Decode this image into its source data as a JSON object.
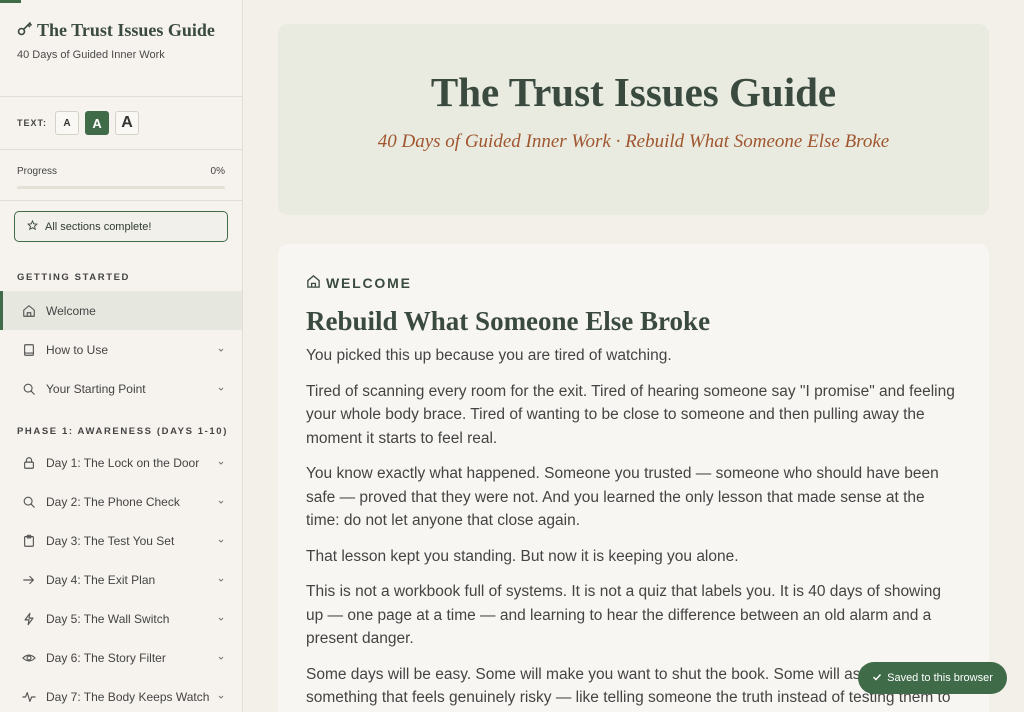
{
  "sidebar": {
    "brand_title": "The Trust Issues Guide",
    "brand_subtitle": "40 Days of Guided Inner Work",
    "text_size_label": "TEXT:",
    "text_size_options": [
      "A",
      "A",
      "A"
    ],
    "text_size_active": 1,
    "progress_label": "Progress",
    "progress_value": "0%",
    "progress_fraction": 0,
    "complete_button": "All sections complete!",
    "sections": [
      {
        "label": "GETTING STARTED",
        "items": [
          {
            "label": "Welcome",
            "icon": "home-icon",
            "active": true
          },
          {
            "label": "How to Use",
            "icon": "book-icon"
          },
          {
            "label": "Your Starting Point",
            "icon": "search-icon"
          }
        ]
      },
      {
        "label": "PHASE 1: AWARENESS (DAYS 1-10)",
        "items": [
          {
            "label": "Day 1: The Lock on the Door",
            "icon": "lock-icon"
          },
          {
            "label": "Day 2: The Phone Check",
            "icon": "search-icon"
          },
          {
            "label": "Day 3: The Test You Set",
            "icon": "clipboard-icon"
          },
          {
            "label": "Day 4: The Exit Plan",
            "icon": "arrow-right-icon"
          },
          {
            "label": "Day 5: The Wall Switch",
            "icon": "lightning-icon"
          },
          {
            "label": "Day 6: The Story Filter",
            "icon": "eye-icon"
          },
          {
            "label": "Day 7: The Body Keeps Watch",
            "icon": "pulse-icon"
          }
        ]
      }
    ]
  },
  "hero": {
    "title": "The Trust Issues Guide",
    "subtitle": "40 Days of Guided Inner Work · Rebuild What Someone Else Broke"
  },
  "card": {
    "eyebrow": "WELCOME",
    "title": "Rebuild What Someone Else Broke",
    "paragraphs": [
      "You picked this up because you are tired of watching.",
      "Tired of scanning every room for the exit. Tired of hearing someone say \"I promise\" and feeling your whole body brace. Tired of wanting to be close to someone and then pulling away the moment it starts to feel real.",
      "You know exactly what happened. Someone you trusted — someone who should have been safe — proved that they were not. And you learned the only lesson that made sense at the time: do not let anyone that close again.",
      "That lesson kept you standing. But now it is keeping you alone.",
      "This is not a workbook full of systems. It is not a quiz that labels you. It is 40 days of showing up — one page at a time — and learning to hear the difference between an old alarm and a present danger.",
      "Some days will be easy. Some will make you want to shut the book. Some will ask you to do something that feels genuinely risky — like telling someone the truth instead of testing them to find it."
    ]
  },
  "toast": {
    "label": "Saved to this browser"
  },
  "colors": {
    "accent": "#3f6b48",
    "subtitle": "#a0562f",
    "heading": "#3a4a3f"
  }
}
